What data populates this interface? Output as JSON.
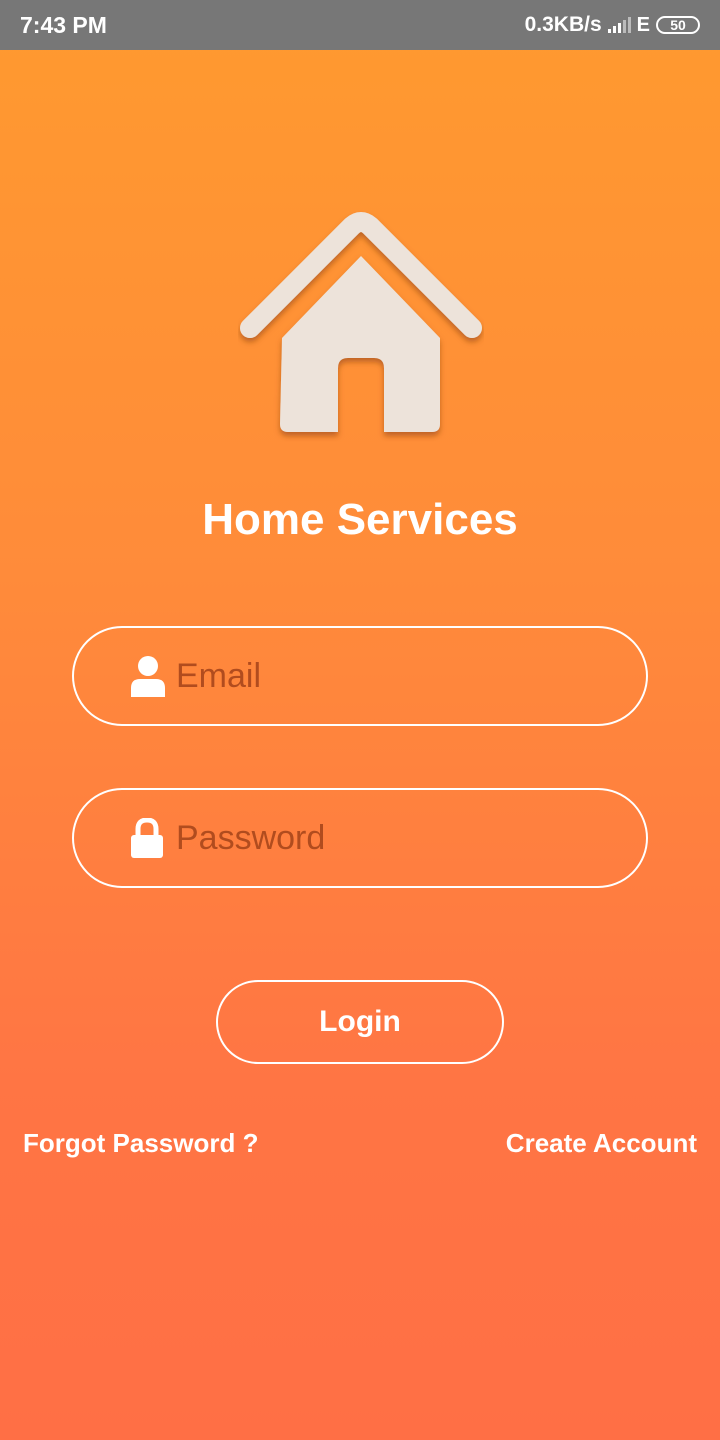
{
  "status_bar": {
    "time": "7:43 PM",
    "speed": "0.3KB/s",
    "network_type": "E",
    "battery": "50"
  },
  "app": {
    "title": "Home Services",
    "logo_icon": "house-icon"
  },
  "form": {
    "email": {
      "placeholder": "Email",
      "value": "",
      "icon": "user-icon"
    },
    "password": {
      "placeholder": "Password",
      "value": "",
      "icon": "lock-icon"
    },
    "login_label": "Login"
  },
  "links": {
    "forgot_password": "Forgot Password ?",
    "create_account": "Create Account"
  },
  "colors": {
    "gradient_top": "#ff9a2f",
    "gradient_bottom": "#ff6f45",
    "placeholder": "#b14c1e",
    "logo_fill": "#ede3da",
    "status_bar": "#777777"
  }
}
